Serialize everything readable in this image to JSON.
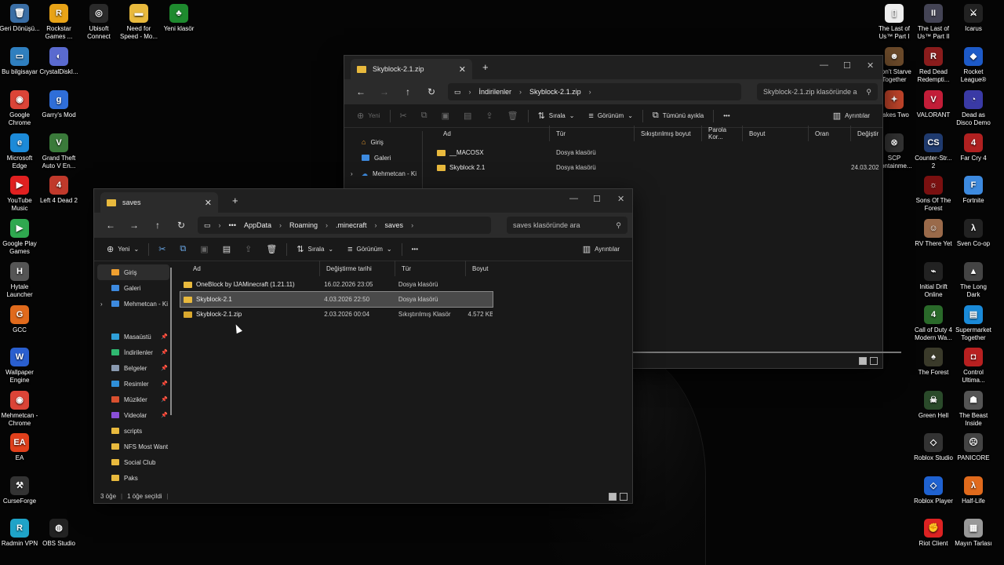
{
  "desktop": {
    "left_icons": [
      {
        "label": "Geri Dönüşü...",
        "color": "#3a6ea5",
        "glyph": "🗑"
      },
      {
        "label": "Rockstar Games ...",
        "color": "#e8a317",
        "glyph": "R"
      },
      {
        "label": "Ubisoft Connect",
        "color": "#2a2a2a",
        "glyph": "◎"
      },
      {
        "label": "Need for Speed - Mo...",
        "color": "#e8b93d",
        "glyph": "▬"
      },
      {
        "label": "Yeni klasör",
        "color": "#1e8a2e",
        "glyph": "♣"
      },
      {
        "label": "Bu bilgisayar",
        "color": "#2f7fbf",
        "glyph": "▭"
      },
      {
        "label": "CrystalDiskI...",
        "color": "#5a6acf",
        "glyph": "◐"
      },
      {
        "label": "Google Chrome",
        "color": "#db4437",
        "glyph": "◉"
      },
      {
        "label": "Garry's Mod",
        "color": "#2f6ed8",
        "glyph": "g"
      },
      {
        "label": "Microsoft Edge",
        "color": "#1c8ad8",
        "glyph": "e"
      },
      {
        "label": "Grand Theft Auto V En...",
        "color": "#3a7a3a",
        "glyph": "V"
      },
      {
        "label": "YouTube Music",
        "color": "#e02020",
        "glyph": "▶"
      },
      {
        "label": "Left 4 Dead 2",
        "color": "#c0392b",
        "glyph": "4"
      },
      {
        "label": "Google Play Games",
        "color": "#2fa84f",
        "glyph": "▶"
      },
      {
        "label": "Hytale Launcher",
        "color": "#555",
        "glyph": "H"
      },
      {
        "label": "GCC",
        "color": "#e06a1c",
        "glyph": "G"
      },
      {
        "label": "Wallpaper Engine",
        "color": "#2a5fcf",
        "glyph": "W"
      },
      {
        "label": "Mehmetcan - Chrome",
        "color": "#db4437",
        "glyph": "◉"
      },
      {
        "label": "EA",
        "color": "#e0401c",
        "glyph": "EA"
      },
      {
        "label": "CurseForge",
        "color": "#333",
        "glyph": "⚒"
      },
      {
        "label": "Radmin VPN",
        "color": "#1fa3c8",
        "glyph": "R"
      },
      {
        "label": "OBS Studio",
        "color": "#222",
        "glyph": "◍"
      }
    ],
    "right_icons": [
      {
        "label": "The Last of Us™ Part I",
        "color": "#eee",
        "glyph": "▯"
      },
      {
        "label": "The Last of Us™ Part II",
        "color": "#445",
        "glyph": "II"
      },
      {
        "label": "Icarus",
        "color": "#222",
        "glyph": "⚔"
      },
      {
        "label": "Don't Starve Together",
        "color": "#6b4a2a",
        "glyph": "☻"
      },
      {
        "label": "Red Dead Redempti...",
        "color": "#8a1c1c",
        "glyph": "R"
      },
      {
        "label": "Rocket League®",
        "color": "#1d5ac8",
        "glyph": "◆"
      },
      {
        "label": "Takes Two",
        "color": "#c0442a",
        "glyph": "✦"
      },
      {
        "label": "VALORANT",
        "color": "#c21d38",
        "glyph": "V"
      },
      {
        "label": "Dead as Disco Demo",
        "color": "#3a3aa5",
        "glyph": "◔"
      },
      {
        "label": "SCP Containme...",
        "color": "#333",
        "glyph": "⊗"
      },
      {
        "label": "Counter-Str... 2",
        "color": "#1f3a6e",
        "glyph": "CS"
      },
      {
        "label": "Far Cry 4",
        "color": "#b02020",
        "glyph": "4"
      },
      {
        "label": "Sons Of The Forest",
        "color": "#7a1010",
        "glyph": "☼"
      },
      {
        "label": "Fortnite",
        "color": "#3d8adf",
        "glyph": "F"
      },
      {
        "label": "RV There Yet",
        "color": "#9a6a4a",
        "glyph": "☺"
      },
      {
        "label": "Sven Co-op",
        "color": "#222",
        "glyph": "λ"
      },
      {
        "label": "Initial Drift Online",
        "color": "#222",
        "glyph": "⌁"
      },
      {
        "label": "The Long Dark",
        "color": "#444",
        "glyph": "▲"
      },
      {
        "label": "Call of Duty 4 Modern Wa...",
        "color": "#2a6a2a",
        "glyph": "4"
      },
      {
        "label": "Supermarket Together",
        "color": "#1a8ad8",
        "glyph": "▤"
      },
      {
        "label": "The Forest",
        "color": "#3a3a2a",
        "glyph": "♠"
      },
      {
        "label": "Control Ultima...",
        "color": "#b82020",
        "glyph": "◘"
      },
      {
        "label": "Green Hell",
        "color": "#2a4a2a",
        "glyph": "☠"
      },
      {
        "label": "The Beast Inside",
        "color": "#555",
        "glyph": "☗"
      },
      {
        "label": "Roblox Studio",
        "color": "#333",
        "glyph": "◇"
      },
      {
        "label": "PANICORE",
        "color": "#444",
        "glyph": "☹"
      },
      {
        "label": "Roblox Player",
        "color": "#1f62d1",
        "glyph": "◇"
      },
      {
        "label": "Half-Life",
        "color": "#e06a1c",
        "glyph": "λ"
      },
      {
        "label": "Riot Client",
        "color": "#d22",
        "glyph": "✊"
      },
      {
        "label": "Mayın Tarlası",
        "color": "#999",
        "glyph": "▦"
      }
    ]
  },
  "back_window": {
    "tab_title": "Skyblock-2.1.zip",
    "breadcrumb": [
      "İndirilenler",
      "Skyblock-2.1.zip"
    ],
    "search_placeholder": "Skyblock-2.1.zip klasöründe a",
    "cmd": {
      "new": "Yeni",
      "sort": "Sırala",
      "view": "Görünüm",
      "extract_all": "Tümünü ayıkla",
      "more": "•••",
      "details": "Ayrıntılar"
    },
    "sidebar": [
      {
        "label": "Giriş",
        "icon": "home-icon",
        "color": "#f0a030"
      },
      {
        "label": "Galeri",
        "icon": "gallery-icon",
        "color": "#3d8adf"
      },
      {
        "label": "Mehmetcan - Ki",
        "icon": "cloud-icon",
        "color": "#3d8adf"
      }
    ],
    "columns": [
      "Ad",
      "Tür",
      "Sıkıştırılmış boyut",
      "Parola Kor...",
      "Boyut",
      "Oran",
      "Değiştir"
    ],
    "rows": [
      {
        "name": "__MACOSX",
        "type": "Dosya klasörü",
        "date": ""
      },
      {
        "name": "Skyblock 2.1",
        "type": "Dosya klasörü",
        "date": "24.03.202"
      }
    ]
  },
  "front_window": {
    "tab_title": "saves",
    "breadcrumb": [
      "AppData",
      "Roaming",
      ".minecraft",
      "saves"
    ],
    "ellipsis": "•••",
    "search_placeholder": "saves klasöründe ara",
    "cmd": {
      "new": "Yeni",
      "sort": "Sırala",
      "view": "Görünüm",
      "more": "•••",
      "details": "Ayrıntılar"
    },
    "sidebar": [
      {
        "label": "Giriş",
        "color": "#f0a030",
        "pin": false,
        "active": true
      },
      {
        "label": "Galeri",
        "color": "#3d8adf",
        "pin": false
      },
      {
        "label": "Mehmetcan - Ki",
        "color": "#3d8adf",
        "pin": false,
        "expand": true
      },
      {
        "label": "Masaüstü",
        "color": "#2f9fd8",
        "pin": true
      },
      {
        "label": "İndirilenler",
        "color": "#2fb870",
        "pin": true
      },
      {
        "label": "Belgeler",
        "color": "#8a9ab0",
        "pin": true
      },
      {
        "label": "Resimler",
        "color": "#2f8fd8",
        "pin": true
      },
      {
        "label": "Müzikler",
        "color": "#d8502f",
        "pin": true
      },
      {
        "label": "Videolar",
        "color": "#8a4fd8",
        "pin": true
      },
      {
        "label": "scripts",
        "color": "#e8b93d",
        "pin": false
      },
      {
        "label": "NFS Most Want",
        "color": "#e8b93d",
        "pin": false
      },
      {
        "label": "Social Club",
        "color": "#e8b93d",
        "pin": false
      },
      {
        "label": "Paks",
        "color": "#e8b93d",
        "pin": false
      }
    ],
    "columns": [
      "Ad",
      "Değiştirme tarihi",
      "Tür",
      "Boyut"
    ],
    "rows": [
      {
        "name": "OneBlock by IJAMinecraft (1.21.11)",
        "date": "16.02.2026 23:05",
        "type": "Dosya klasörü",
        "size": "",
        "zip": false,
        "selected": false
      },
      {
        "name": "Skyblock-2.1",
        "date": "4.03.2026 22:50",
        "type": "Dosya klasörü",
        "size": "",
        "zip": false,
        "selected": true
      },
      {
        "name": "Skyblock-2.1.zip",
        "date": "2.03.2026 00:04",
        "type": "Sıkıştırılmış Klasör",
        "size": "4.572 KB",
        "zip": true,
        "selected": false
      }
    ],
    "status_count": "3 öğe",
    "status_selected": "1 öğe seçildi"
  }
}
